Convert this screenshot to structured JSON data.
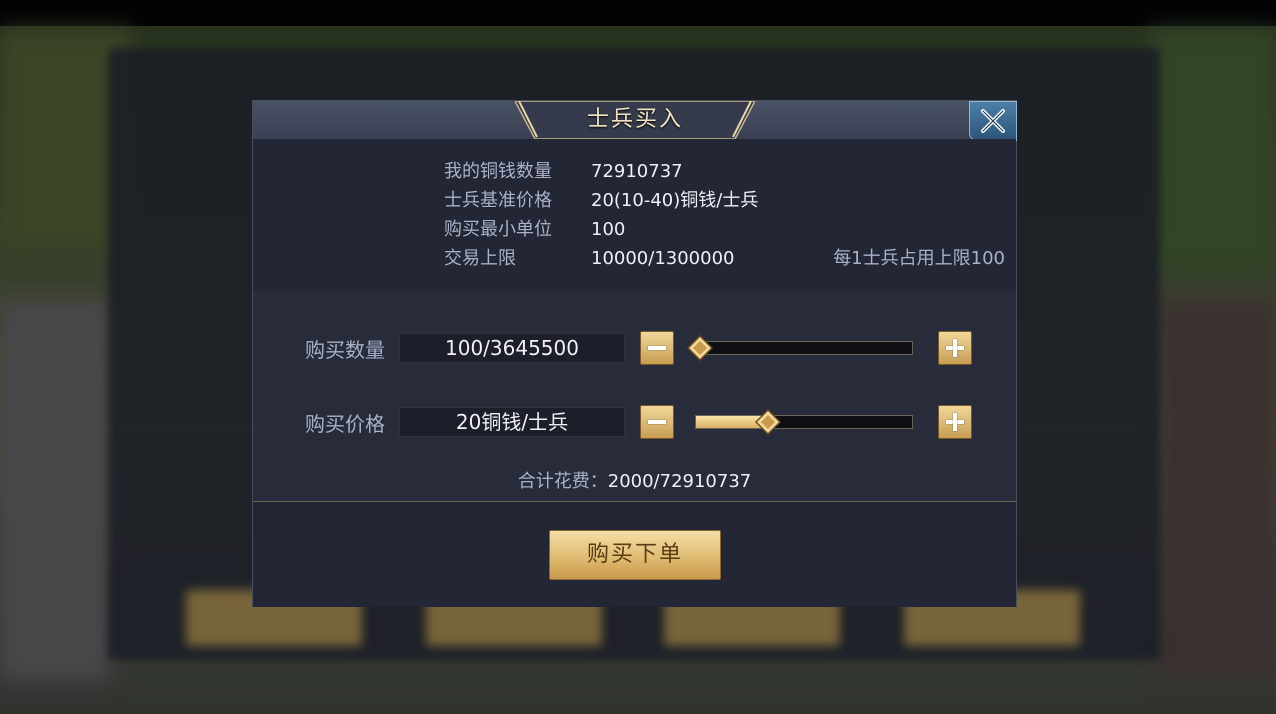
{
  "dialog": {
    "title": "士兵买入"
  },
  "info": {
    "rows": [
      {
        "label": "我的铜钱数量",
        "value": "72910737"
      },
      {
        "label": "士兵基准价格",
        "value": "20(10-40)铜钱/士兵"
      },
      {
        "label": "购买最小单位",
        "value": "100"
      },
      {
        "label": "交易上限",
        "value": "10000/1300000",
        "note": "每1士兵占用上限100"
      }
    ]
  },
  "quantity": {
    "label": "购买数量",
    "value": "100/3645500",
    "slider_fraction": 0.0
  },
  "price": {
    "label": "购买价格",
    "value": "20铜钱/士兵",
    "slider_fraction": 0.333
  },
  "total": {
    "label": "合计花费：",
    "value": "2000/72910737"
  },
  "order_button": {
    "label": "购买下单"
  },
  "colors": {
    "accent_gold": "#e0bc72",
    "label_text": "#a9b0c8",
    "value_text": "#eef0f6",
    "close_blue": "#2c5478"
  },
  "icons": {
    "close": "close-x-icon",
    "minus": "minus-icon",
    "plus": "plus-icon",
    "slider_thumb": "diamond-thumb-icon"
  }
}
